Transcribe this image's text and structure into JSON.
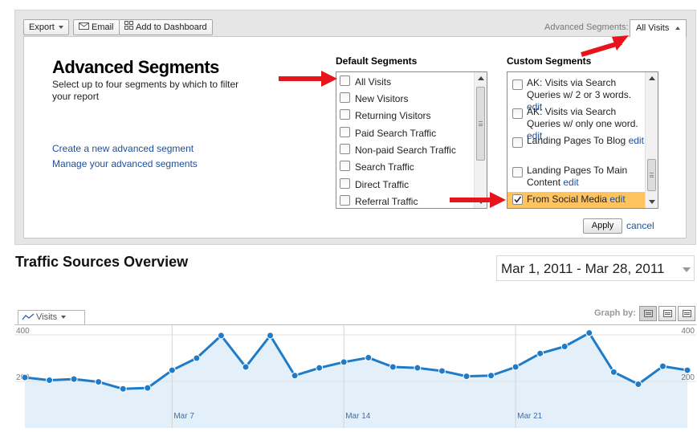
{
  "toolbar": {
    "export_label": "Export",
    "email_label": "Email",
    "dashboard_label": "Add to Dashboard",
    "advanced_segments_label": "Advanced Segments:",
    "current_segment": "All Visits"
  },
  "segments_panel": {
    "title": "Advanced Segments",
    "subtitle": "Select up to four segments by which to filter your report",
    "create_link": "Create a new advanced segment",
    "manage_link": "Manage your advanced segments",
    "default_heading": "Default Segments",
    "custom_heading": "Custom Segments",
    "default_segments": [
      {
        "label": "All Visits",
        "checked": false
      },
      {
        "label": "New Visitors",
        "checked": false
      },
      {
        "label": "Returning Visitors",
        "checked": false
      },
      {
        "label": "Paid Search Traffic",
        "checked": false
      },
      {
        "label": "Non-paid Search Traffic",
        "checked": false
      },
      {
        "label": "Search Traffic",
        "checked": false
      },
      {
        "label": "Direct Traffic",
        "checked": false
      },
      {
        "label": "Referral Traffic",
        "checked": false
      }
    ],
    "custom_segments": [
      {
        "label": "AK: Visits via Search Queries w/ 2 or 3 words.",
        "edit": "edit",
        "checked": false,
        "selected": false
      },
      {
        "label": "AK: Visits via Search Queries w/ only one word.",
        "edit": "edit",
        "checked": false,
        "selected": false
      },
      {
        "label": "Landing Pages To Blog",
        "edit": "edit",
        "checked": false,
        "selected": false
      },
      {
        "label": "Landing Pages To Main Content",
        "edit": "edit",
        "checked": false,
        "selected": false
      },
      {
        "label": "From Social Media",
        "edit": "edit",
        "checked": true,
        "selected": true
      }
    ],
    "apply_label": "Apply",
    "cancel_label": "cancel"
  },
  "report": {
    "title": "Traffic Sources Overview",
    "date_range": "Mar 1, 2011 - Mar 28, 2011",
    "metric_tab": "Visits",
    "graph_by_label": "Graph by:"
  },
  "colors": {
    "line": "#1f7bc8",
    "fill": "#e3eff9",
    "link": "#1a4f9c",
    "highlight": "#ffc35f",
    "arrow": "#e8141b"
  },
  "chart_data": {
    "type": "area",
    "metric": "Visits",
    "x": [
      "Mar 1",
      "Mar 2",
      "Mar 3",
      "Mar 4",
      "Mar 5",
      "Mar 6",
      "Mar 7",
      "Mar 8",
      "Mar 9",
      "Mar 10",
      "Mar 11",
      "Mar 12",
      "Mar 13",
      "Mar 14",
      "Mar 15",
      "Mar 16",
      "Mar 17",
      "Mar 18",
      "Mar 19",
      "Mar 20",
      "Mar 21",
      "Mar 22",
      "Mar 23",
      "Mar 24",
      "Mar 25",
      "Mar 26",
      "Mar 27",
      "Mar 28"
    ],
    "values": [
      217,
      205,
      210,
      198,
      168,
      172,
      248,
      300,
      397,
      262,
      397,
      225,
      258,
      283,
      302,
      262,
      258,
      245,
      222,
      225,
      262,
      320,
      350,
      408,
      240,
      188,
      265,
      248
    ],
    "y_ticks": [
      400,
      200
    ],
    "x_tick_labels": [
      "Mar 7",
      "Mar 14",
      "Mar 21"
    ],
    "ylim": [
      0,
      470
    ],
    "grid": true
  }
}
